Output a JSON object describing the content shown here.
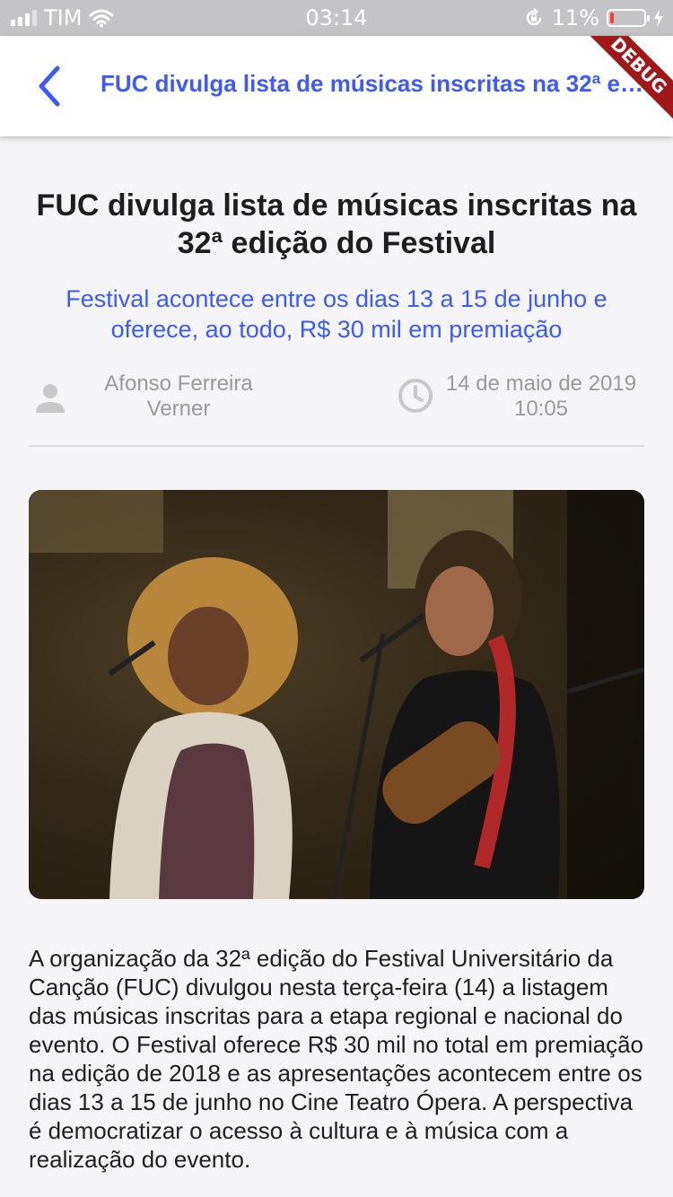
{
  "status_bar": {
    "carrier": "TIM",
    "time": "03:14",
    "battery_percent": "11%",
    "battery_level": 0.11
  },
  "app_bar": {
    "title": "FUC divulga lista de músicas inscritas na 32ª edição do Festival",
    "debug_label": "DEBUG"
  },
  "article": {
    "headline": "FUC divulga lista de músicas inscritas na 32ª edição do Festival",
    "subheadline": "Festival acontece entre os dias 13 a 15 de junho e oferece, ao todo, R$ 30 mil em premiação",
    "author_line1": "Afonso Ferreira",
    "author_line2": "Verner",
    "date": "14 de maio de 2019",
    "time": "10:05",
    "body": "A organização da 32ª edição do Festival Universitário da Canção (FUC) divulgou nesta terça-feira (14) a listagem das músicas inscritas para a etapa regional e nacional do evento. O Festival oferece R$ 30 mil no total em premiação na edição de 2018 e as apresentações acontecem entre os dias 13 a 15 de junho no Cine Teatro Ópera. A perspectiva é democratizar o acesso à cultura e à música com a realização do evento."
  },
  "colors": {
    "accent": "#3d5afe",
    "background": "#f5f5f7",
    "status_bar": "#c4c4c6",
    "meta_text": "#9a9a9a"
  },
  "icons": [
    "signal-icon",
    "wifi-icon",
    "lock-rotation-icon",
    "battery-icon",
    "charging-icon",
    "back-arrow-icon",
    "person-icon",
    "clock-icon"
  ]
}
